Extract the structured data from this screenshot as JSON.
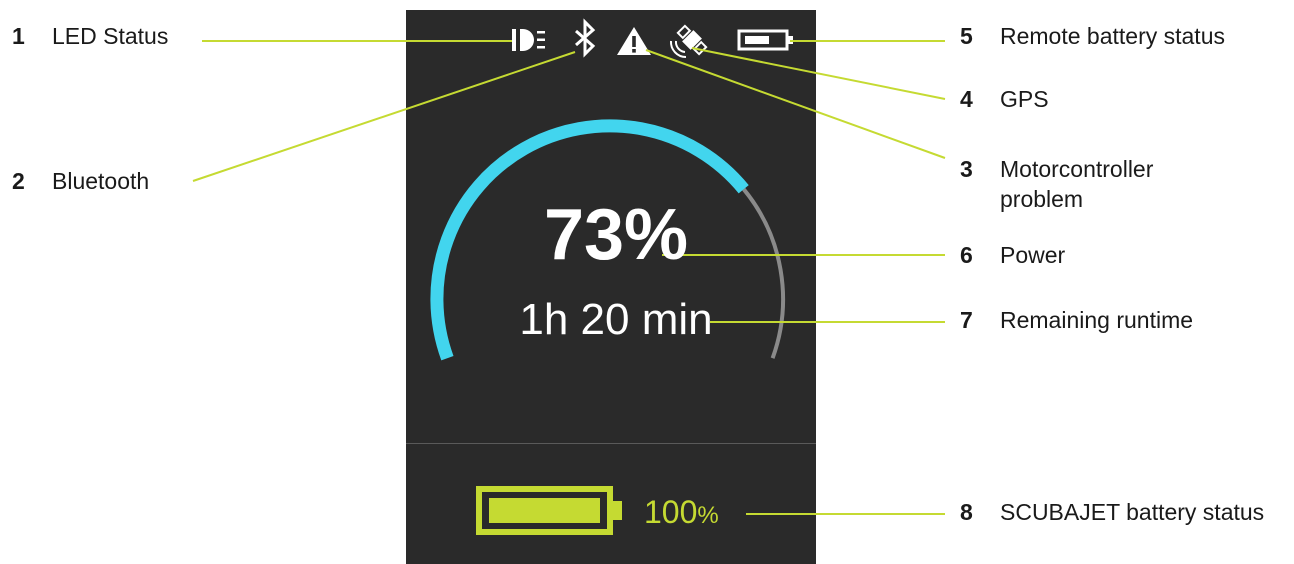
{
  "display": {
    "power_percent": "73%",
    "power_level": 0.73,
    "remaining_runtime": "1h 20 min",
    "scubajet_battery_value": "100",
    "scubajet_battery_unit": "%",
    "scubajet_battery_level": 1.0
  },
  "status_icons": [
    {
      "icon": "led-status-icon"
    },
    {
      "icon": "bluetooth-icon"
    },
    {
      "icon": "warning-icon"
    },
    {
      "icon": "gps-satellite-icon"
    },
    {
      "icon": "remote-battery-icon"
    }
  ],
  "callouts": [
    {
      "number": "1",
      "text": "LED Status"
    },
    {
      "number": "2",
      "text": "Bluetooth"
    },
    {
      "number": "3",
      "text": "Motorcontroller problem"
    },
    {
      "number": "4",
      "text": "GPS"
    },
    {
      "number": "5",
      "text": "Remote battery status"
    },
    {
      "number": "6",
      "text": "Power"
    },
    {
      "number": "7",
      "text": "Remaining runtime"
    },
    {
      "number": "8",
      "text": "SCUBAJET battery status"
    }
  ],
  "colors": {
    "screen_bg": "#2a2a2a",
    "gauge_fill": "#42d5ee",
    "gauge_track": "#8a8a8a",
    "accent_green": "#c5da32",
    "leader_line": "#c5da32",
    "label_text": "#1a1a1a"
  }
}
